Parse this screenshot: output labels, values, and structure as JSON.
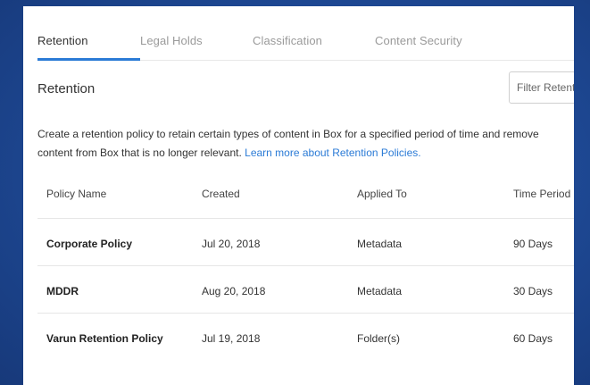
{
  "tabs": [
    {
      "label": "Retention",
      "active": true
    },
    {
      "label": "Legal Holds",
      "active": false
    },
    {
      "label": "Classification",
      "active": false
    },
    {
      "label": "Content Security",
      "active": false
    }
  ],
  "section": {
    "title": "Retention"
  },
  "filter": {
    "placeholder": "Filter Retention Policies"
  },
  "description": {
    "text": "Create a retention policy to retain certain types of content in Box for a specified period of time and remove content from Box that is no longer relevant.",
    "link": "Learn more about Retention Policies."
  },
  "table": {
    "columns": [
      "Policy Name",
      "Created",
      "Applied To",
      "Time Period"
    ],
    "rows": [
      {
        "name": "Corporate Policy",
        "created": "Jul 20, 2018",
        "applied_to": "Metadata",
        "period": "90 Days"
      },
      {
        "name": "MDDR",
        "created": "Aug 20, 2018",
        "applied_to": "Metadata",
        "period": "30 Days"
      },
      {
        "name": "Varun Retention Policy",
        "created": "Jul 19, 2018",
        "applied_to": "Folder(s)",
        "period": "60 Days"
      }
    ]
  },
  "colors": {
    "accent": "#2b7bd6",
    "background": "#1f4b98"
  }
}
